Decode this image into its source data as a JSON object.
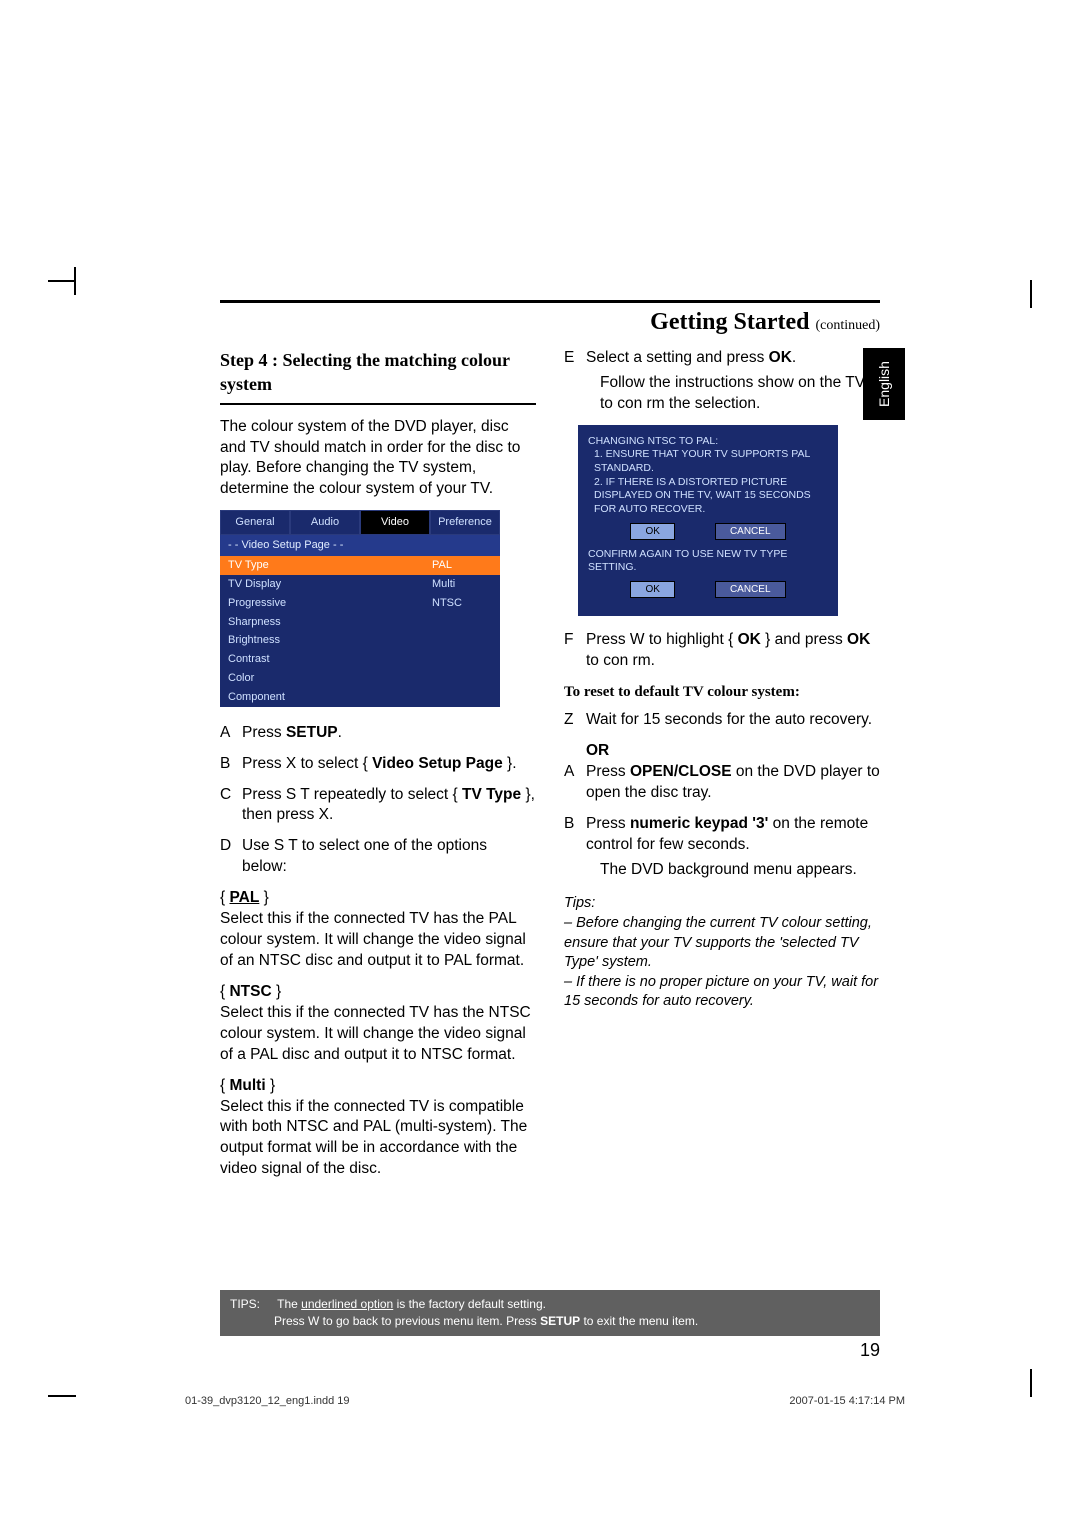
{
  "header": {
    "title": "Getting Started",
    "continued": "(continued)"
  },
  "language_tab": "English",
  "left_col": {
    "step_title": "Step 4 : Selecting the matching colour system",
    "intro": "The colour system of the DVD player, disc and TV should match in order for the disc to play. Before changing the TV system, determine the colour system of your TV.",
    "menu": {
      "tabs": [
        "General",
        "Audio",
        "Video",
        "Preference"
      ],
      "active_tab": 2,
      "header": "- -   Video Setup Page   - -",
      "rows": [
        {
          "k": "TV Type",
          "v": "PAL",
          "sel": true
        },
        {
          "k": "TV Display",
          "v": "Multi"
        },
        {
          "k": "Progressive",
          "v": "NTSC"
        },
        {
          "k": "Sharpness",
          "v": ""
        },
        {
          "k": "Brightness",
          "v": ""
        },
        {
          "k": "Contrast",
          "v": ""
        },
        {
          "k": "Color",
          "v": ""
        },
        {
          "k": "Component",
          "v": ""
        }
      ]
    },
    "steps_a": {
      "marker": "A",
      "pre": "Press ",
      "bold": "SETUP",
      "post": "."
    },
    "steps_b": {
      "marker": "B",
      "pre": "Press X to select { ",
      "bold": "Video Setup Page",
      "post": " }."
    },
    "steps_c": {
      "marker": "C",
      "pre": "Press S  T repeatedly to select { ",
      "bold": "TV Type",
      "post": " }, then press X."
    },
    "steps_d": {
      "marker": "D",
      "text": "Use S  T to select one of the options below:"
    },
    "options": [
      {
        "label": "PAL",
        "underline": true,
        "text": "Select this if the connected TV has the PAL colour system. It will change the video signal of an NTSC disc and output it to PAL format."
      },
      {
        "label": "NTSC",
        "underline": false,
        "text": "Select this if the connected TV has the NTSC colour system. It will change the video signal of a PAL disc and output it to NTSC format."
      },
      {
        "label": "Multi",
        "underline": false,
        "text": "Select this if the connected TV is compatible with both NTSC and PAL (multi-system). The output format will be in accordance with the video signal of the disc."
      }
    ]
  },
  "right_col": {
    "steps_e": {
      "marker": "E",
      "pre": "Select a setting and press ",
      "bold": "OK",
      "post": "."
    },
    "steps_e_sub": "Follow the instructions show on the TV to con rm the selection.",
    "dialog": {
      "title": "CHANGING NTSC TO PAL:",
      "line1": "1. ENSURE THAT YOUR TV SUPPORTS PAL STANDARD.",
      "line2": "2. IF THERE IS A DISTORTED PICTURE DISPLAYED ON THE TV, WAIT 15 SECONDS FOR AUTO RECOVER.",
      "btn_ok": "OK",
      "btn_cancel": "CANCEL",
      "confirm": "CONFIRM AGAIN TO USE NEW TV TYPE SETTING."
    },
    "steps_f": {
      "marker": "F",
      "pre": "Press W to highlight { ",
      "bold1": "OK",
      "mid": " } and press ",
      "bold2": "OK",
      "post": " to con rm."
    },
    "reset_head": "To reset to default TV colour system:",
    "reset_z": {
      "marker": "Z",
      "text": "Wait for 15 seconds for the auto recovery."
    },
    "or": "OR",
    "reset_a": {
      "marker": "A",
      "pre": "Press ",
      "bold": "OPEN/CLOSE",
      "post": "       on the DVD player to open the disc tray."
    },
    "reset_b": {
      "marker": "B",
      "pre": "Press ",
      "bold": "numeric keypad '3'",
      "post": " on the remote control for few seconds."
    },
    "reset_b_sub": "The DVD background menu appears.",
    "tips_label": "Tips:",
    "tips1": "– Before changing the current TV colour setting, ensure that your TV supports the 'selected TV Type' system.",
    "tips2": "– If there is no proper picture on your TV, wait for 15 seconds for auto recovery."
  },
  "tips_bar": {
    "label": "TIPS:",
    "line1a": "The ",
    "line1u": "underlined option",
    "line1b": " is the factory default setting.",
    "line2a": "Press W to go back to previous menu item. Press ",
    "line2b": "SETUP",
    "line2c": " to exit the menu item."
  },
  "page_number": "19",
  "footer_left": "01-39_dvp3120_12_eng1.indd   19",
  "footer_right": "2007-01-15   4:17:14 PM"
}
